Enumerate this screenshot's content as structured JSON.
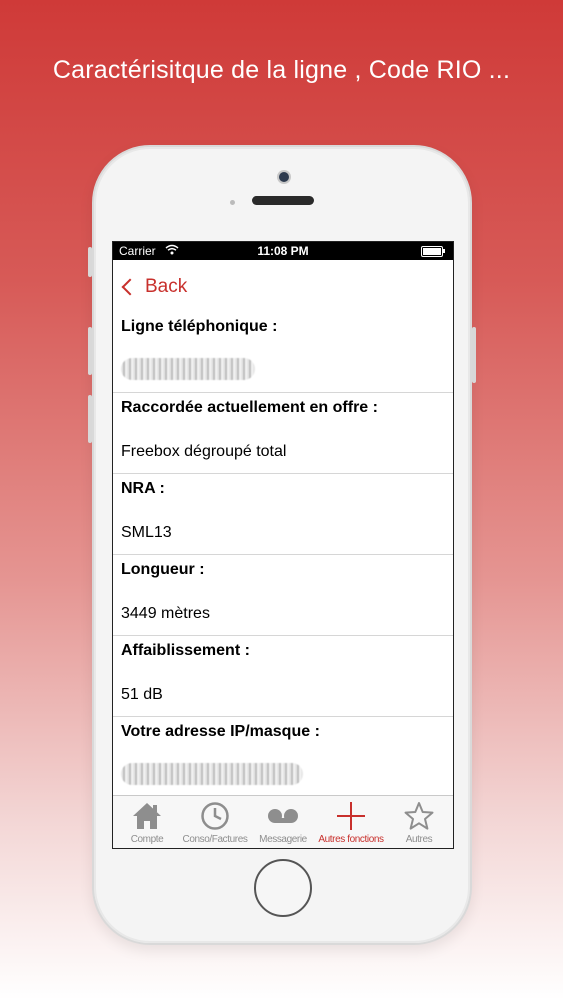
{
  "headline": "Caractérisitque de la ligne , Code RIO ...",
  "statusbar": {
    "carrier": "Carrier",
    "time": "11:08 PM"
  },
  "nav": {
    "back_label": "Back"
  },
  "sections": [
    {
      "label": "Ligne téléphonique :",
      "value": ""
    },
    {
      "label": "Raccordée actuellement en offre  :",
      "value": "Freebox dégroupé total"
    },
    {
      "label": "NRA :",
      "value": "SML13"
    },
    {
      "label": "Longueur :",
      "value": "3449 mètres"
    },
    {
      "label": "Affaiblissement :",
      "value": "51 dB"
    },
    {
      "label": "Votre adresse IP/masque :",
      "value": ""
    }
  ],
  "tabbar": {
    "tabs": [
      {
        "label": "Compte",
        "icon": "home-icon"
      },
      {
        "label": "Conso/Factures",
        "icon": "clock-icon"
      },
      {
        "label": "Messagerie",
        "icon": "voicemail-icon"
      },
      {
        "label": "Autres fonctions",
        "icon": "plus-icon"
      },
      {
        "label": "Autres",
        "icon": "star-icon"
      }
    ],
    "active_index": 3
  },
  "colors": {
    "accent": "#c8302c",
    "inactive": "#8e8e8e"
  }
}
